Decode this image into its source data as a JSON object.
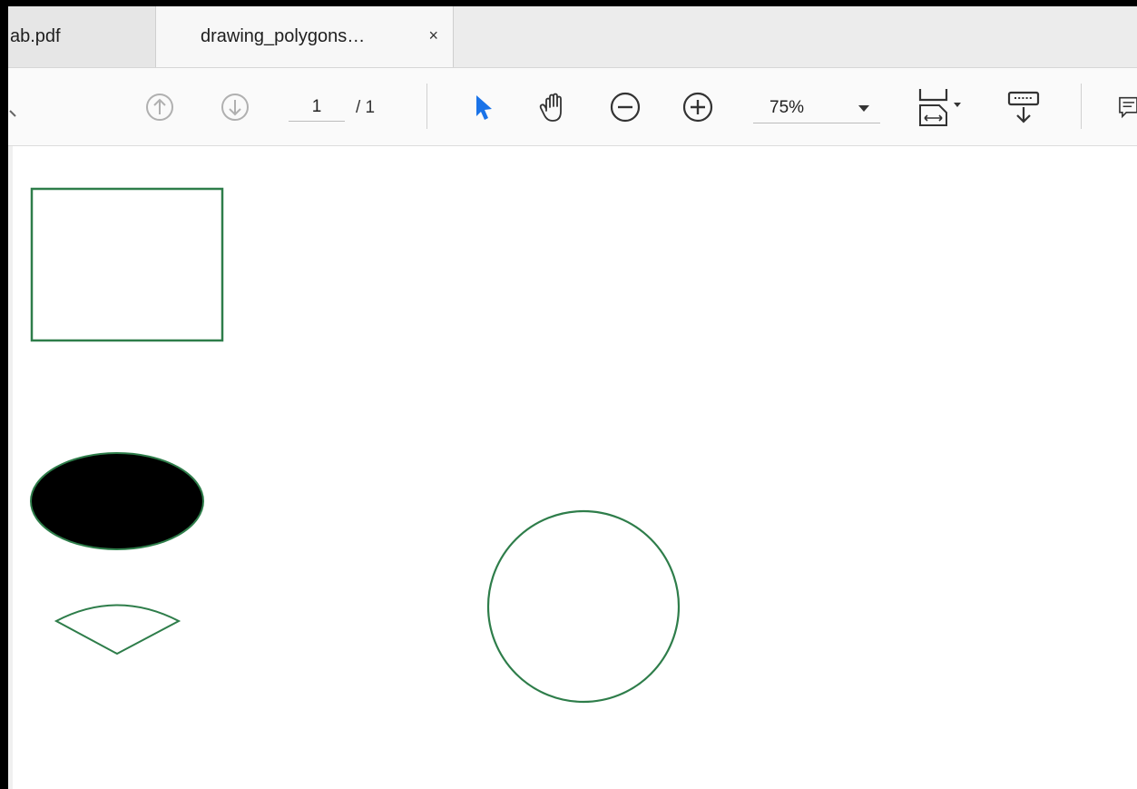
{
  "tabs": [
    {
      "label": "ab.pdf",
      "active": false
    },
    {
      "label": "drawing_polygons…",
      "active": true
    }
  ],
  "tab_close_symbol": "×",
  "toolbar": {
    "page_current": "1",
    "page_total": "/ 1",
    "zoom": "75%",
    "icons": [
      "previous-page-icon",
      "next-page-icon",
      "select-tool-icon",
      "hand-tool-icon",
      "zoom-out-icon",
      "zoom-in-icon",
      "page-fit-icon",
      "scrolling-mode-icon",
      "comment-icon"
    ]
  },
  "colors": {
    "shape_stroke": "#2e7d4a",
    "ellipse_fill": "#000000",
    "select_tool": "#1a73e8"
  }
}
